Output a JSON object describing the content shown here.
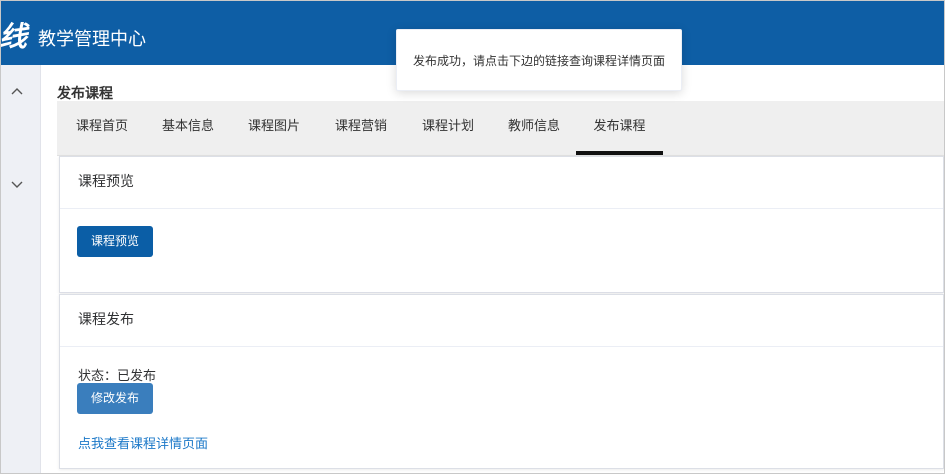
{
  "header": {
    "logo_text": "线",
    "app_title": "教学管理中心",
    "bg_color": "#0e5ea5"
  },
  "sidebar": {
    "icons": [
      "chevron-up-icon",
      "chevron-down-icon"
    ]
  },
  "page": {
    "section_title": "发布课程"
  },
  "tabs": [
    {
      "label": "课程首页",
      "active": false
    },
    {
      "label": "基本信息",
      "active": false
    },
    {
      "label": "课程图片",
      "active": false
    },
    {
      "label": "课程营销",
      "active": false
    },
    {
      "label": "课程计划",
      "active": false
    },
    {
      "label": "教师信息",
      "active": false
    },
    {
      "label": "发布课程",
      "active": true
    }
  ],
  "preview_card": {
    "title": "课程预览",
    "button_label": "课程预览"
  },
  "publish_card": {
    "title": "课程发布",
    "status_text": "状态：已发布",
    "button_label": "修改发布",
    "link_text": "点我查看课程详情页面"
  },
  "toast": {
    "message": "发布成功，请点击下边的链接查询课程详情页面"
  },
  "colors": {
    "primary": "#0b5ea6",
    "secondary_button": "#3a7ebd",
    "link": "#1b78c8"
  }
}
